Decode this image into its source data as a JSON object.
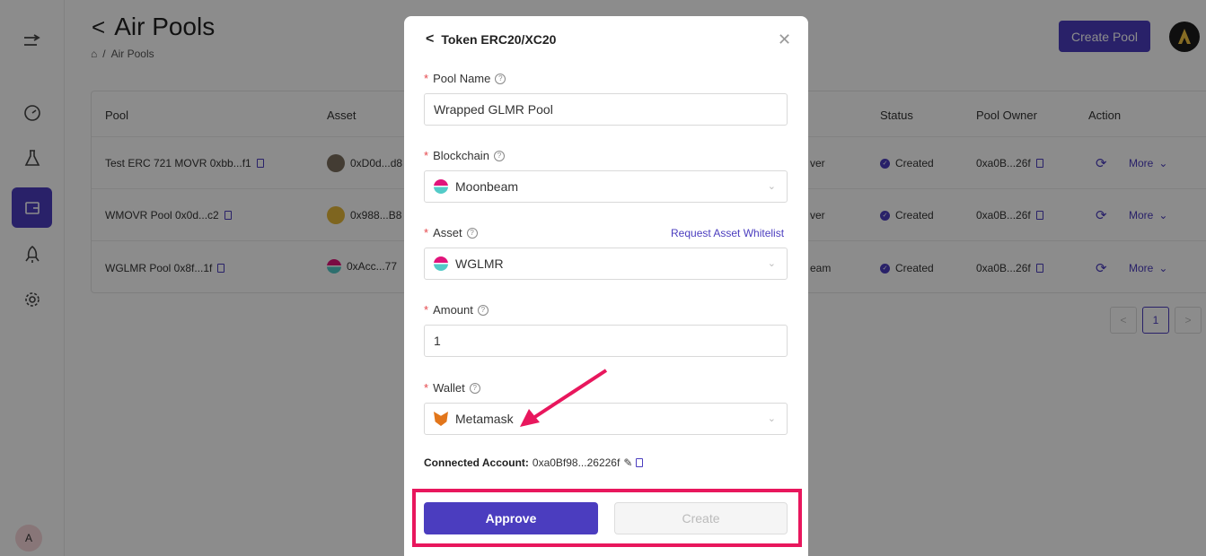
{
  "page": {
    "title": "Air Pools",
    "breadcrumb": [
      "Air Pools"
    ],
    "create_pool_label": "Create Pool",
    "top_avatar_letter": "A"
  },
  "sidebar": {
    "bottom_avatar": "A",
    "icons": [
      "expand-icon",
      "dashboard-icon",
      "flask-icon",
      "wallet-icon",
      "rocket-icon",
      "settings-icon"
    ]
  },
  "table": {
    "headers": [
      "Pool",
      "Asset",
      "Status",
      "Pool Owner",
      "Action"
    ],
    "rows": [
      {
        "pool": "Test ERC 721 MOVR 0xbb...f1",
        "asset": "0xD0d...d8",
        "chain": "ver",
        "status": "Created",
        "owner": "0xa0B...26f",
        "more": "More"
      },
      {
        "pool": "WMOVR Pool 0x0d...c2",
        "asset": "0x988...B8",
        "chain": "ver",
        "status": "Created",
        "owner": "0xa0B...26f",
        "more": "More"
      },
      {
        "pool": "WGLMR Pool 0x8f...1f",
        "asset": "0xAcc...77",
        "chain": "eam",
        "status": "Created",
        "owner": "0xa0B...26f",
        "more": "More"
      }
    ],
    "page": "1"
  },
  "modal": {
    "title": "Token ERC20/XC20",
    "pool_name_label": "Pool Name",
    "pool_name_value": "Wrapped GLMR Pool",
    "blockchain_label": "Blockchain",
    "blockchain_value": "Moonbeam",
    "asset_label": "Asset",
    "asset_link": "Request Asset Whitelist",
    "asset_value": "WGLMR",
    "amount_label": "Amount",
    "amount_value": "1",
    "wallet_label": "Wallet",
    "wallet_value": "Metamask",
    "connected_label": "Connected Account:",
    "connected_value": "0xa0Bf98...26226f",
    "approve_label": "Approve",
    "create_label": "Create"
  },
  "colors": {
    "accent": "#4b3dbf",
    "highlight": "#e8175d",
    "required": "#e5484d"
  }
}
